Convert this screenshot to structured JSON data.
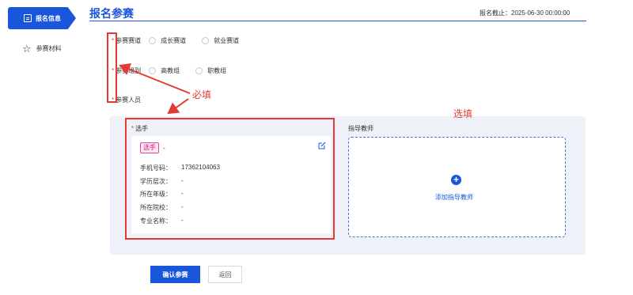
{
  "sidebar": {
    "items": [
      {
        "label": "报名信息",
        "icon": "form-icon",
        "active": true
      },
      {
        "label": "参赛材料",
        "icon": "star-icon",
        "active": false
      }
    ]
  },
  "header": {
    "title": "报名参赛",
    "deadline": "报名截止：2025-06-30 00:00:00"
  },
  "form": {
    "track": {
      "label": "参赛赛道",
      "options": [
        "成长赛道",
        "就业赛道"
      ]
    },
    "group": {
      "label": "参赛组别",
      "options": [
        "高教组",
        "职教组"
      ]
    },
    "members": {
      "label": "参赛人员"
    }
  },
  "player": {
    "section_label": "选手",
    "badge": "选手",
    "name": "-",
    "fields": [
      {
        "key": "手机号码：",
        "value": "17362104063"
      },
      {
        "key": "学历层次：",
        "value": "-"
      },
      {
        "key": "所在年级：",
        "value": "-"
      },
      {
        "key": "所在院校：",
        "value": "-"
      },
      {
        "key": "专业名称：",
        "value": "-"
      }
    ]
  },
  "mentor": {
    "section_label": "指导教师",
    "add_label": "添加指导教师"
  },
  "annotations": {
    "required": "必填",
    "optional": "选填",
    "color": "#e53935"
  },
  "buttons": {
    "confirm": "确认参赛",
    "back": "返回"
  },
  "colors": {
    "primary": "#1a56db",
    "required_mark": "#e53935",
    "badge": "#d6177a"
  }
}
